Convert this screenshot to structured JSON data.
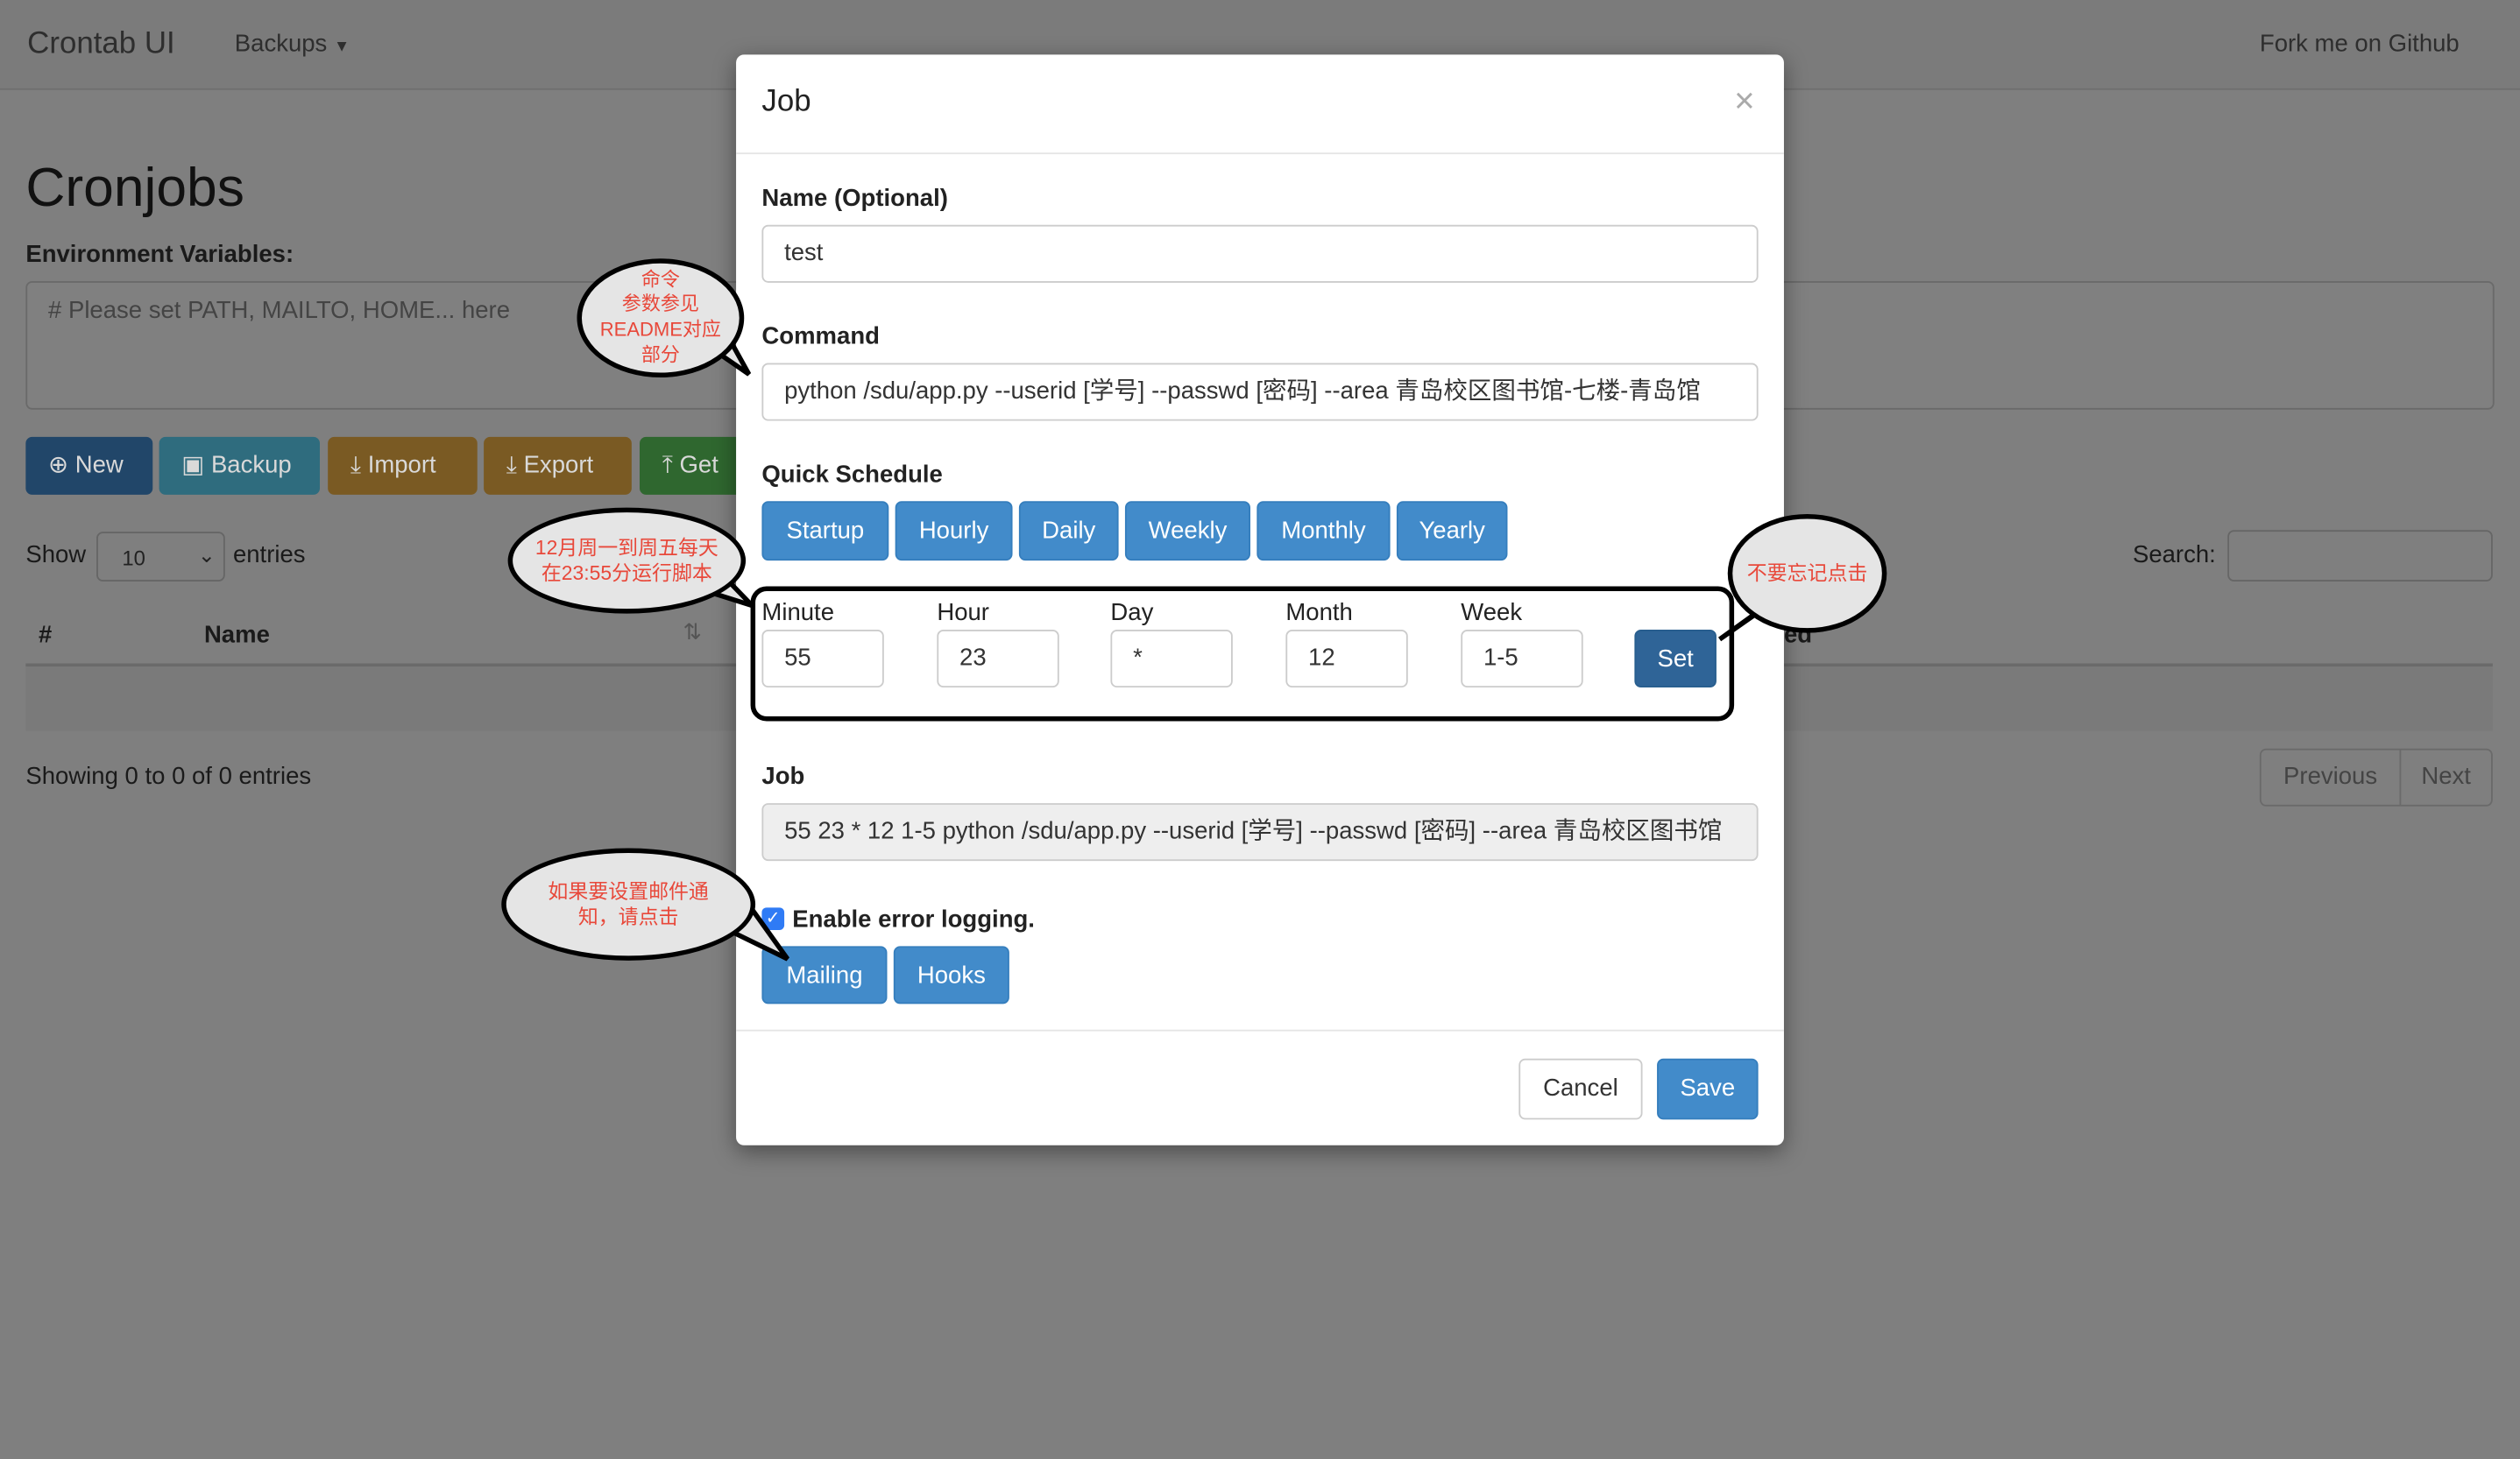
{
  "navbar": {
    "brand": "Crontab UI",
    "backups": "Backups",
    "fork": "Fork me on Github"
  },
  "page": {
    "title": "Cronjobs",
    "env_label": "Environment Variables:",
    "env_placeholder": "# Please set PATH, MAILTO, HOME... here",
    "buttons": {
      "new": "New",
      "backup": "Backup",
      "import": "Import",
      "export": "Export",
      "get": "Get"
    },
    "show": "Show",
    "entries_value": "10",
    "entries": "entries",
    "search": "Search:",
    "columns": [
      "#",
      "Name",
      "ed"
    ],
    "showing": "Showing 0 to 0 of 0 entries",
    "previous": "Previous",
    "next": "Next"
  },
  "modal": {
    "title": "Job",
    "close": "×",
    "name_label": "Name (Optional)",
    "name_value": "test",
    "command_label": "Command",
    "command_value": "python /sdu/app.py --userid [学号] --passwd [密码] --area 青岛校区图书馆-七楼-青岛馆",
    "quick_label": "Quick Schedule",
    "quick": [
      "Startup",
      "Hourly",
      "Daily",
      "Weekly",
      "Monthly",
      "Yearly"
    ],
    "schedule": {
      "minute_label": "Minute",
      "minute": "55",
      "hour_label": "Hour",
      "hour": "23",
      "day_label": "Day",
      "day": "*",
      "month_label": "Month",
      "month": "12",
      "week_label": "Week",
      "week": "1-5",
      "set": "Set"
    },
    "job_label": "Job",
    "job_value": "55 23 * 12 1-5 python /sdu/app.py --userid [学号] --passwd [密码] --area 青岛校区图书馆",
    "error_logging": "Enable error logging.",
    "error_logging_checked": true,
    "mailing": "Mailing",
    "hooks": "Hooks",
    "cancel": "Cancel",
    "save": "Save"
  },
  "annotations": {
    "command": "命令\n参数参见\nREADME对应\n部分",
    "schedule": "12月周一到周五每天\n在23:55分运行脚本",
    "set": "不要忘记点击",
    "mail": "如果要设置邮件通\n知，请点击"
  },
  "colors": {
    "primary": "#428bca",
    "annotation_text": "#e8483a"
  }
}
